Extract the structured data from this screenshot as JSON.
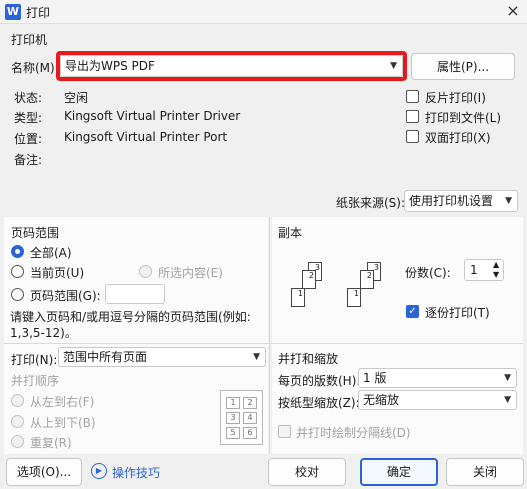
{
  "window": {
    "logo": "W",
    "title": "打印",
    "close": "×"
  },
  "printer": {
    "section": "打印机",
    "name_label": "名称(M):",
    "name_value": "导出为WPS PDF",
    "properties_button": "属性(P)...",
    "status_label": "状态:",
    "status_value": "空闲",
    "type_label": "类型:",
    "type_value": "Kingsoft Virtual Printer Driver",
    "location_label": "位置:",
    "location_value": "Kingsoft Virtual Printer Port",
    "comment_label": "备注:",
    "reverse_print": "反片打印(I)",
    "print_to_file": "打印到文件(L)",
    "duplex": "双面打印(X)",
    "paper_source_label": "纸张来源(S):",
    "paper_source_value": "使用打印机设置"
  },
  "page_range": {
    "section": "页码范围",
    "all": "全部(A)",
    "current": "当前页(U)",
    "selection": "所选内容(E)",
    "pages": "页码范围(G):",
    "pages_value": "",
    "hint_line1": "请键入页码和/或用逗号分隔的页码范围(例如:",
    "hint_line2": "1,3,5-12)。"
  },
  "print_what": {
    "label": "打印(N):",
    "value": "范围中所有页面"
  },
  "order": {
    "section": "并打顺序",
    "ltr": "从左到右(F)",
    "ttb": "从上到下(B)",
    "repeat": "重复(R)",
    "grid": [
      "1",
      "2",
      "3",
      "4",
      "5",
      "6"
    ]
  },
  "copies": {
    "section": "副本",
    "count_label": "份数(C):",
    "count_value": "1",
    "collate": "逐份打印(T)",
    "page_numbers": [
      "1",
      "2",
      "3"
    ]
  },
  "zoom": {
    "section": "并打和缩放",
    "pages_per_sheet_label": "每页的版数(H):",
    "pages_per_sheet_value": "1 版",
    "scale_label": "按纸型缩放(Z):",
    "scale_value": "无缩放",
    "draw_borders": "并打时绘制分隔线(D)"
  },
  "footer": {
    "options": "选项(O)...",
    "tips": "操作技巧",
    "tips_icon": "play-circle-icon",
    "proofread": "校对",
    "ok": "确定",
    "close": "关闭"
  },
  "colors": {
    "accent": "#2b64d8",
    "highlight": "#e8191b"
  }
}
